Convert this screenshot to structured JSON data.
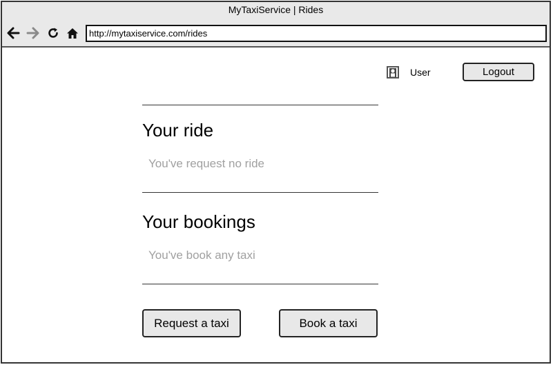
{
  "window": {
    "title": "MyTaxiService | Rides"
  },
  "toolbar": {
    "back_icon": "arrow-left-icon",
    "forward_icon": "arrow-right-icon",
    "reload_icon": "reload-icon",
    "home_icon": "home-icon",
    "url": "http://mytaxiservice.com/rides"
  },
  "header": {
    "user_icon": "user-avatar-icon",
    "user_label": "User",
    "logout_label": "Logout"
  },
  "ride": {
    "title": "Your ride",
    "empty_text": "You've request no ride"
  },
  "bookings": {
    "title": "Your bookings",
    "empty_text": "You've book any taxi"
  },
  "actions": {
    "request_label": "Request a taxi",
    "book_label": "Book a taxi"
  },
  "colors": {
    "chrome_bg": "#e9e9e9",
    "button_bg": "#e8e8e8",
    "muted_text": "#a0a0a0"
  }
}
